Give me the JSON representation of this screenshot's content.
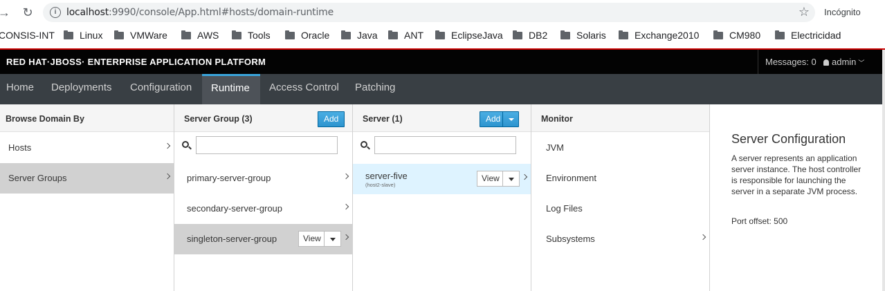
{
  "browser": {
    "url_host": "localhost",
    "url_path": ":9990/console/App.html#hosts/domain-runtime",
    "incognito_label": "Incógnito",
    "bookmarks": [
      "CONSIS-INT",
      "Linux",
      "VMWare",
      "AWS",
      "Tools",
      "Oracle",
      "Java",
      "ANT",
      "EclipseJava",
      "DB2",
      "Solaris",
      "Exchange2010",
      "CM980",
      "Electricidad"
    ]
  },
  "header": {
    "brand": "RED HAT·JBOSS· ENTERPRISE APPLICATION PLATFORM",
    "messages": "Messages: 0",
    "user": "admin"
  },
  "nav": {
    "tabs": [
      "Home",
      "Deployments",
      "Configuration",
      "Runtime",
      "Access Control",
      "Patching"
    ],
    "active": "Runtime"
  },
  "browse": {
    "title": "Browse Domain By",
    "items": [
      "Hosts",
      "Server Groups"
    ],
    "selected": "Server Groups"
  },
  "server_group": {
    "title": "Server Group (3)",
    "add_label": "Add",
    "filter_value": "",
    "items": [
      "primary-server-group",
      "secondary-server-group",
      "singleton-server-group"
    ],
    "selected": "singleton-server-group",
    "view_label": "View"
  },
  "server": {
    "title": "Server (1)",
    "add_label": "Add",
    "filter_value": "",
    "items": [
      {
        "name": "server-five",
        "host": "(host2-slave)"
      }
    ],
    "view_label": "View"
  },
  "monitor": {
    "title": "Monitor",
    "items": [
      "JVM",
      "Environment",
      "Log Files",
      "Subsystems"
    ]
  },
  "preview": {
    "title": "Server Configuration",
    "description": "A server represents an application server instance. The host controller is responsible for launching the server in a separate JVM process.",
    "port_offset": "Port offset: 500"
  },
  "colors": {
    "accent": "#39a5dc",
    "nav_bg": "#393f44",
    "selected_row": "#d1d1d1",
    "selected_blue": "#def3ff"
  }
}
